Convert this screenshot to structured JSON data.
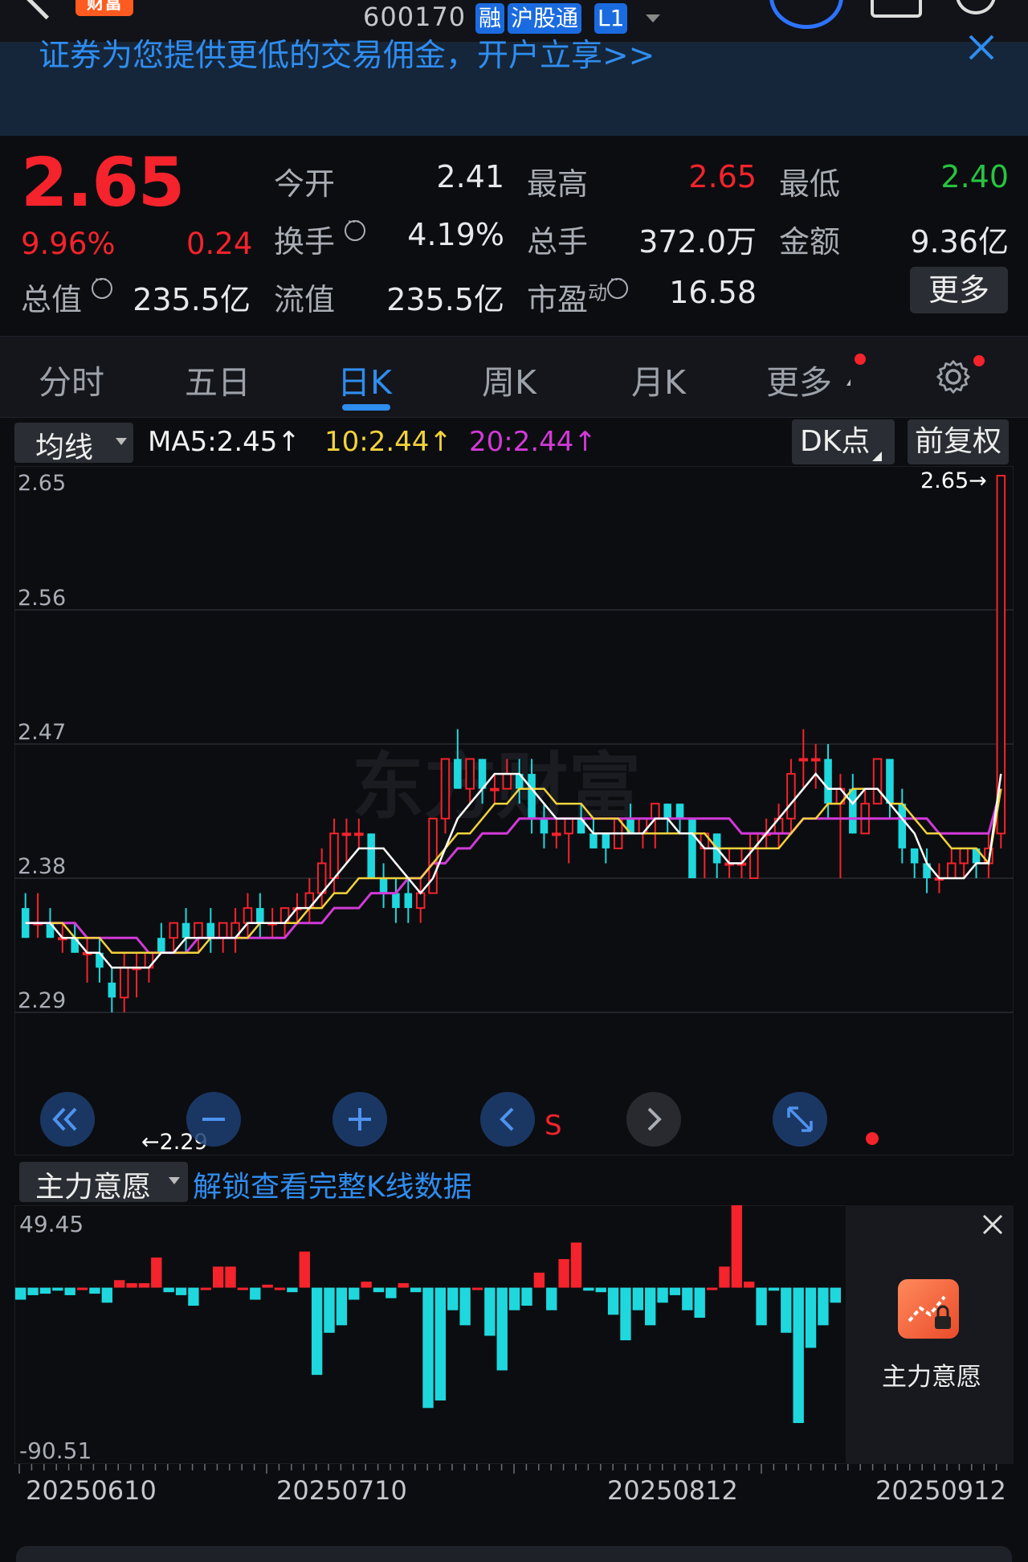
{
  "header": {
    "logo_text": "财富",
    "stock_code": "600170",
    "tags": [
      "融",
      "沪股通",
      "L1"
    ]
  },
  "banner": {
    "text": "证券为您提供更低的交易佣金，开户立享>>"
  },
  "quote": {
    "price": "2.65",
    "change_pct": "9.96%",
    "change": "0.24",
    "stats": [
      {
        "label": "今开",
        "value": "2.41",
        "color": "#e6e8ec"
      },
      {
        "label": "最高",
        "value": "2.65",
        "color": "#f4232c"
      },
      {
        "label": "最低",
        "value": "2.40",
        "color": "#27c43f"
      },
      {
        "label": "换手",
        "value": "4.19%",
        "color": "#e6e8ec"
      },
      {
        "label": "总手",
        "value": "372.0万",
        "color": "#e6e8ec"
      },
      {
        "label": "金额",
        "value": "9.36亿",
        "color": "#e6e8ec"
      },
      {
        "label": "总值",
        "value": "235.5亿",
        "color": "#e6e8ec"
      },
      {
        "label": "流值",
        "value": "235.5亿",
        "color": "#e6e8ec"
      },
      {
        "label": "市盈",
        "value": "16.58",
        "color": "#e6e8ec"
      }
    ],
    "pe_superscript": "动",
    "more_label": "更多"
  },
  "tabs": [
    "分时",
    "五日",
    "日K",
    "周K",
    "月K",
    "更多"
  ],
  "active_tab": "日K",
  "ma": {
    "selector": "均线",
    "ma5": "MA5:2.45↑",
    "ma10": "10:2.44↑",
    "ma20": "20:2.44↑",
    "dk_label": "DK点",
    "adjust_label": "前复权"
  },
  "kline": {
    "y_ticks": [
      "2.65",
      "2.56",
      "2.47",
      "2.38",
      "2.29"
    ],
    "high_marker": "2.65→",
    "low_marker": "←2.29",
    "watermark": "东方财富",
    "signal_label": "S",
    "colors": {
      "up": "#f4232c",
      "down": "#1ed8de",
      "ma5": "#ffffff",
      "ma10": "#f2d23c",
      "ma20": "#d23ad8"
    }
  },
  "chart_data": {
    "type": "candlestick",
    "ylim": [
      2.29,
      2.65
    ],
    "candles": [
      {
        "o": 2.36,
        "h": 2.37,
        "l": 2.34,
        "c": 2.34
      },
      {
        "o": 2.35,
        "h": 2.37,
        "l": 2.34,
        "c": 2.35
      },
      {
        "o": 2.35,
        "h": 2.36,
        "l": 2.34,
        "c": 2.34
      },
      {
        "o": 2.34,
        "h": 2.35,
        "l": 2.33,
        "c": 2.34
      },
      {
        "o": 2.34,
        "h": 2.35,
        "l": 2.33,
        "c": 2.33
      },
      {
        "o": 2.33,
        "h": 2.34,
        "l": 2.31,
        "c": 2.33
      },
      {
        "o": 2.33,
        "h": 2.34,
        "l": 2.31,
        "c": 2.32
      },
      {
        "o": 2.31,
        "h": 2.32,
        "l": 2.29,
        "c": 2.3
      },
      {
        "o": 2.3,
        "h": 2.33,
        "l": 2.29,
        "c": 2.32
      },
      {
        "o": 2.32,
        "h": 2.33,
        "l": 2.3,
        "c": 2.32
      },
      {
        "o": 2.32,
        "h": 2.33,
        "l": 2.31,
        "c": 2.33
      },
      {
        "o": 2.34,
        "h": 2.35,
        "l": 2.33,
        "c": 2.33
      },
      {
        "o": 2.34,
        "h": 2.35,
        "l": 2.33,
        "c": 2.35
      },
      {
        "o": 2.35,
        "h": 2.36,
        "l": 2.33,
        "c": 2.34
      },
      {
        "o": 2.34,
        "h": 2.35,
        "l": 2.33,
        "c": 2.35
      },
      {
        "o": 2.35,
        "h": 2.36,
        "l": 2.33,
        "c": 2.34
      },
      {
        "o": 2.34,
        "h": 2.35,
        "l": 2.33,
        "c": 2.35
      },
      {
        "o": 2.34,
        "h": 2.36,
        "l": 2.33,
        "c": 2.35
      },
      {
        "o": 2.35,
        "h": 2.37,
        "l": 2.34,
        "c": 2.36
      },
      {
        "o": 2.36,
        "h": 2.37,
        "l": 2.34,
        "c": 2.35
      },
      {
        "o": 2.35,
        "h": 2.36,
        "l": 2.34,
        "c": 2.35
      },
      {
        "o": 2.35,
        "h": 2.36,
        "l": 2.34,
        "c": 2.36
      },
      {
        "o": 2.36,
        "h": 2.37,
        "l": 2.35,
        "c": 2.36
      },
      {
        "o": 2.36,
        "h": 2.38,
        "l": 2.35,
        "c": 2.37
      },
      {
        "o": 2.37,
        "h": 2.4,
        "l": 2.36,
        "c": 2.39
      },
      {
        "o": 2.38,
        "h": 2.42,
        "l": 2.37,
        "c": 2.41
      },
      {
        "o": 2.41,
        "h": 2.42,
        "l": 2.39,
        "c": 2.41
      },
      {
        "o": 2.41,
        "h": 2.42,
        "l": 2.4,
        "c": 2.41
      },
      {
        "o": 2.41,
        "h": 2.41,
        "l": 2.38,
        "c": 2.38
      },
      {
        "o": 2.38,
        "h": 2.39,
        "l": 2.36,
        "c": 2.37
      },
      {
        "o": 2.37,
        "h": 2.38,
        "l": 2.35,
        "c": 2.36
      },
      {
        "o": 2.37,
        "h": 2.38,
        "l": 2.35,
        "c": 2.36
      },
      {
        "o": 2.36,
        "h": 2.38,
        "l": 2.35,
        "c": 2.37
      },
      {
        "o": 2.37,
        "h": 2.42,
        "l": 2.37,
        "c": 2.42
      },
      {
        "o": 2.42,
        "h": 2.46,
        "l": 2.41,
        "c": 2.46
      },
      {
        "o": 2.46,
        "h": 2.48,
        "l": 2.44,
        "c": 2.44
      },
      {
        "o": 2.44,
        "h": 2.46,
        "l": 2.43,
        "c": 2.46
      },
      {
        "o": 2.46,
        "h": 2.46,
        "l": 2.43,
        "c": 2.44
      },
      {
        "o": 2.44,
        "h": 2.45,
        "l": 2.43,
        "c": 2.44
      },
      {
        "o": 2.44,
        "h": 2.46,
        "l": 2.44,
        "c": 2.45
      },
      {
        "o": 2.45,
        "h": 2.46,
        "l": 2.43,
        "c": 2.44
      },
      {
        "o": 2.45,
        "h": 2.46,
        "l": 2.41,
        "c": 2.42
      },
      {
        "o": 2.42,
        "h": 2.43,
        "l": 2.4,
        "c": 2.41
      },
      {
        "o": 2.41,
        "h": 2.42,
        "l": 2.4,
        "c": 2.41
      },
      {
        "o": 2.41,
        "h": 2.42,
        "l": 2.39,
        "c": 2.42
      },
      {
        "o": 2.42,
        "h": 2.43,
        "l": 2.41,
        "c": 2.41
      },
      {
        "o": 2.41,
        "h": 2.42,
        "l": 2.4,
        "c": 2.4
      },
      {
        "o": 2.41,
        "h": 2.41,
        "l": 2.39,
        "c": 2.4
      },
      {
        "o": 2.4,
        "h": 2.42,
        "l": 2.4,
        "c": 2.42
      },
      {
        "o": 2.42,
        "h": 2.43,
        "l": 2.41,
        "c": 2.41
      },
      {
        "o": 2.41,
        "h": 2.42,
        "l": 2.4,
        "c": 2.42
      },
      {
        "o": 2.42,
        "h": 2.43,
        "l": 2.4,
        "c": 2.43
      },
      {
        "o": 2.43,
        "h": 2.43,
        "l": 2.41,
        "c": 2.42
      },
      {
        "o": 2.43,
        "h": 2.43,
        "l": 2.41,
        "c": 2.42
      },
      {
        "o": 2.42,
        "h": 2.42,
        "l": 2.38,
        "c": 2.38
      },
      {
        "o": 2.4,
        "h": 2.41,
        "l": 2.38,
        "c": 2.41
      },
      {
        "o": 2.41,
        "h": 2.41,
        "l": 2.38,
        "c": 2.39
      },
      {
        "o": 2.39,
        "h": 2.4,
        "l": 2.38,
        "c": 2.39
      },
      {
        "o": 2.39,
        "h": 2.4,
        "l": 2.38,
        "c": 2.39
      },
      {
        "o": 2.38,
        "h": 2.41,
        "l": 2.38,
        "c": 2.41
      },
      {
        "o": 2.41,
        "h": 2.42,
        "l": 2.4,
        "c": 2.41
      },
      {
        "o": 2.41,
        "h": 2.43,
        "l": 2.4,
        "c": 2.42
      },
      {
        "o": 2.42,
        "h": 2.46,
        "l": 2.41,
        "c": 2.45
      },
      {
        "o": 2.46,
        "h": 2.48,
        "l": 2.44,
        "c": 2.46
      },
      {
        "o": 2.46,
        "h": 2.47,
        "l": 2.44,
        "c": 2.46
      },
      {
        "o": 2.46,
        "h": 2.47,
        "l": 2.42,
        "c": 2.43
      },
      {
        "o": 2.43,
        "h": 2.45,
        "l": 2.38,
        "c": 2.44
      },
      {
        "o": 2.44,
        "h": 2.45,
        "l": 2.41,
        "c": 2.41
      },
      {
        "o": 2.41,
        "h": 2.44,
        "l": 2.41,
        "c": 2.43
      },
      {
        "o": 2.43,
        "h": 2.46,
        "l": 2.43,
        "c": 2.46
      },
      {
        "o": 2.46,
        "h": 2.46,
        "l": 2.42,
        "c": 2.43
      },
      {
        "o": 2.43,
        "h": 2.44,
        "l": 2.39,
        "c": 2.4
      },
      {
        "o": 2.4,
        "h": 2.4,
        "l": 2.38,
        "c": 2.39
      },
      {
        "o": 2.39,
        "h": 2.4,
        "l": 2.37,
        "c": 2.38
      },
      {
        "o": 2.38,
        "h": 2.39,
        "l": 2.37,
        "c": 2.38
      },
      {
        "o": 2.38,
        "h": 2.4,
        "l": 2.38,
        "c": 2.39
      },
      {
        "o": 2.39,
        "h": 2.4,
        "l": 2.38,
        "c": 2.4
      },
      {
        "o": 2.4,
        "h": 2.4,
        "l": 2.38,
        "c": 2.39
      },
      {
        "o": 2.39,
        "h": 2.41,
        "l": 2.38,
        "c": 2.4
      },
      {
        "o": 2.41,
        "h": 2.65,
        "l": 2.4,
        "c": 2.65
      }
    ],
    "ma5": [
      2.35,
      2.35,
      2.35,
      2.34,
      2.34,
      2.33,
      2.33,
      2.32,
      2.32,
      2.32,
      2.32,
      2.33,
      2.33,
      2.34,
      2.34,
      2.34,
      2.34,
      2.34,
      2.35,
      2.35,
      2.35,
      2.35,
      2.36,
      2.36,
      2.37,
      2.38,
      2.39,
      2.4,
      2.4,
      2.4,
      2.39,
      2.38,
      2.37,
      2.38,
      2.4,
      2.42,
      2.43,
      2.44,
      2.45,
      2.45,
      2.45,
      2.44,
      2.43,
      2.42,
      2.42,
      2.42,
      2.41,
      2.41,
      2.41,
      2.41,
      2.41,
      2.42,
      2.42,
      2.41,
      2.41,
      2.4,
      2.4,
      2.39,
      2.39,
      2.4,
      2.41,
      2.42,
      2.43,
      2.44,
      2.45,
      2.44,
      2.44,
      2.43,
      2.44,
      2.44,
      2.43,
      2.42,
      2.41,
      2.39,
      2.38,
      2.38,
      2.38,
      2.39,
      2.39,
      2.45
    ],
    "ma10": [
      2.35,
      2.35,
      2.35,
      2.35,
      2.34,
      2.34,
      2.34,
      2.33,
      2.33,
      2.33,
      2.33,
      2.33,
      2.33,
      2.33,
      2.33,
      2.34,
      2.34,
      2.34,
      2.34,
      2.35,
      2.35,
      2.35,
      2.35,
      2.36,
      2.36,
      2.37,
      2.37,
      2.38,
      2.38,
      2.38,
      2.38,
      2.38,
      2.38,
      2.39,
      2.4,
      2.41,
      2.41,
      2.42,
      2.43,
      2.43,
      2.44,
      2.44,
      2.44,
      2.43,
      2.43,
      2.43,
      2.42,
      2.42,
      2.42,
      2.41,
      2.41,
      2.41,
      2.41,
      2.41,
      2.41,
      2.41,
      2.4,
      2.4,
      2.4,
      2.4,
      2.4,
      2.4,
      2.41,
      2.42,
      2.42,
      2.43,
      2.43,
      2.44,
      2.44,
      2.44,
      2.43,
      2.43,
      2.42,
      2.41,
      2.41,
      2.4,
      2.4,
      2.4,
      2.39,
      2.44
    ],
    "ma20": [
      2.35,
      2.35,
      2.35,
      2.35,
      2.35,
      2.34,
      2.34,
      2.34,
      2.34,
      2.34,
      2.33,
      2.33,
      2.33,
      2.33,
      2.34,
      2.34,
      2.34,
      2.34,
      2.34,
      2.34,
      2.34,
      2.34,
      2.35,
      2.35,
      2.35,
      2.36,
      2.36,
      2.36,
      2.37,
      2.37,
      2.37,
      2.38,
      2.38,
      2.39,
      2.39,
      2.4,
      2.4,
      2.41,
      2.41,
      2.41,
      2.42,
      2.42,
      2.42,
      2.42,
      2.42,
      2.42,
      2.42,
      2.42,
      2.42,
      2.42,
      2.42,
      2.42,
      2.42,
      2.42,
      2.42,
      2.42,
      2.42,
      2.42,
      2.41,
      2.41,
      2.41,
      2.41,
      2.41,
      2.42,
      2.42,
      2.42,
      2.42,
      2.42,
      2.42,
      2.42,
      2.42,
      2.42,
      2.42,
      2.42,
      2.41,
      2.41,
      2.41,
      2.41,
      2.41,
      2.44
    ]
  },
  "indicator": {
    "selector": "主力意愿",
    "unlock_text": "解锁查看完整K线数据",
    "max_label": "49.45",
    "min_label": "-90.51",
    "lock_label": "主力意愿",
    "values": [
      -8,
      -5,
      -4,
      -2,
      -5,
      0,
      -4,
      -10,
      5,
      3,
      3,
      20,
      -3,
      -5,
      -12,
      0,
      14,
      14,
      0,
      -8,
      2,
      0,
      -3,
      24,
      -58,
      -30,
      -25,
      -8,
      4,
      -3,
      -7,
      3,
      -3,
      -80,
      -75,
      -15,
      -25,
      0,
      -32,
      -55,
      -15,
      -12,
      10,
      -15,
      19,
      30,
      -2,
      -3,
      -18,
      -35,
      -15,
      -25,
      -10,
      -5,
      -15,
      -20,
      0,
      14,
      65,
      4,
      -25,
      -2,
      -30,
      -90,
      -40,
      -25,
      -10
    ]
  },
  "dates": [
    "20250610",
    "20250710",
    "20250812",
    "20250912"
  ]
}
